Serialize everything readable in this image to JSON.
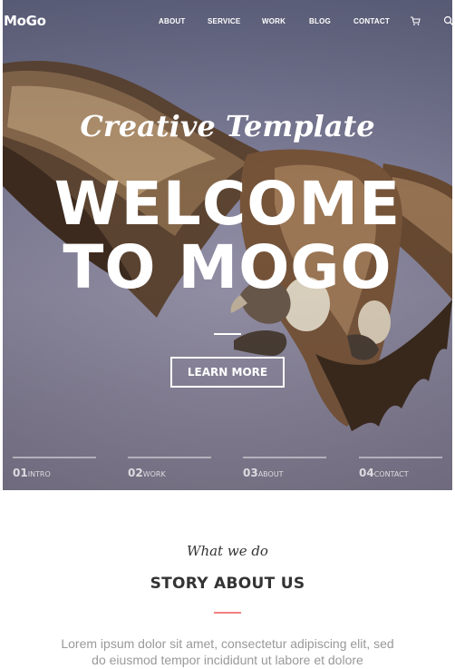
{
  "nav": {
    "logo": "MoGo",
    "links": [
      "ABOUT",
      "SERVICE",
      "WORK",
      "BLOG",
      "CONTACT"
    ],
    "icons": [
      "cart-icon",
      "search-icon"
    ]
  },
  "hero": {
    "tagline": "Creative Template",
    "headline_line1": "WELCOME",
    "headline_line2": "TO MOGO",
    "button_label": "LEARN MORE",
    "slides": [
      {
        "num": "01",
        "label": "INTRO"
      },
      {
        "num": "02",
        "label": "WORK"
      },
      {
        "num": "03",
        "label": "ABOUT"
      },
      {
        "num": "04",
        "label": "CONTACT"
      }
    ]
  },
  "about": {
    "subtitle": "What we do",
    "title": "STORY ABOUT US",
    "text": "Lorem ipsum dolor sit amet, consectetur adipiscing elit, sed do eiusmod tempor incididunt ut labore et dolore"
  },
  "colors": {
    "accent": "#f38181",
    "text_dark": "#333333",
    "text_muted": "#999999"
  }
}
